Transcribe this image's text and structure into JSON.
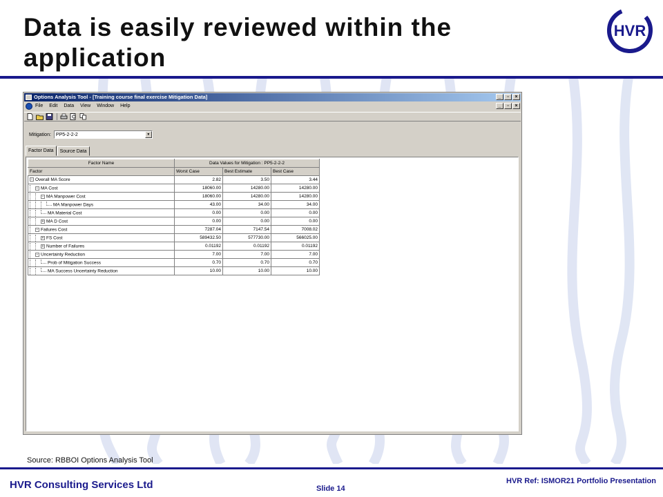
{
  "slide": {
    "title_line1": "Data is easily reviewed within the",
    "title_line2": "application",
    "logo_text": "HVR",
    "source": "Source: RBBOI Options Analysis Tool",
    "footer_company": "HVR Consulting Services Ltd",
    "footer_slide": "Slide 14",
    "footer_ref": "HVR Ref:  ISMOR21 Portfolio Presentation",
    "colors": {
      "brand": "#1a1a8c",
      "window_face": "#d4d0c8",
      "titlebar": "#0a246a"
    }
  },
  "window": {
    "title": "Options Analysis Tool - [Training course final exercise Mitigation Data]",
    "menu": [
      "File",
      "Edit",
      "Data",
      "View",
      "Window",
      "Help"
    ],
    "toolbar_icons": [
      "new-icon",
      "open-icon",
      "save-icon",
      "print-icon",
      "print-preview-icon",
      "copy-icon"
    ],
    "mitigation_label": "Mitigation:",
    "mitigation_value": "PP5-2-2-2",
    "tabs": [
      "Factor Data",
      "Source Data"
    ],
    "active_tab": "Factor Data"
  },
  "grid": {
    "group_header_name": "Factor Name",
    "group_header_values": "Data Values for Mitigation : PP5-2-2-2",
    "columns": [
      "Factor",
      "Worst Case",
      "Best Estimate",
      "Best Case"
    ],
    "rows": [
      {
        "name": "Overall MA Score",
        "level": 0,
        "node": "minus",
        "worst": "2.82",
        "estimate": "3.50",
        "best": "3.44"
      },
      {
        "name": "MA Cost",
        "level": 1,
        "node": "minus",
        "worst": "18060.00",
        "estimate": "14280.00",
        "best": "14280.00"
      },
      {
        "name": "MA Manpower Cost",
        "level": 2,
        "node": "minus",
        "worst": "18060.00",
        "estimate": "14280.00",
        "best": "14280.00"
      },
      {
        "name": "MA Manpower Days",
        "level": 3,
        "node": "leaf",
        "worst": "43.00",
        "estimate": "34.00",
        "best": "34.00"
      },
      {
        "name": "MA Material Cost",
        "level": 2,
        "node": "leaf",
        "worst": "0.00",
        "estimate": "0.00",
        "best": "0.00"
      },
      {
        "name": "MA D Cost",
        "level": 2,
        "node": "plus",
        "worst": "0.00",
        "estimate": "0.00",
        "best": "0.00"
      },
      {
        "name": "Failures Cost",
        "level": 1,
        "node": "minus",
        "worst": "7287.04",
        "estimate": "7147.54",
        "best": "7008.02"
      },
      {
        "name": "FS Cost",
        "level": 2,
        "node": "plus",
        "worst": "589432.50",
        "estimate": "577730.00",
        "best": "566025.00"
      },
      {
        "name": "Number of Failures",
        "level": 2,
        "node": "plus",
        "worst": "0.01192",
        "estimate": "0.01192",
        "best": "0.01192"
      },
      {
        "name": "Uncertainty Reduction",
        "level": 1,
        "node": "minus",
        "worst": "7.00",
        "estimate": "7.00",
        "best": "7.00"
      },
      {
        "name": "Prob of Mitigation Success",
        "level": 2,
        "node": "leaf",
        "worst": "0.70",
        "estimate": "0.70",
        "best": "0.70"
      },
      {
        "name": "MA Success Uncertainty Reduction",
        "level": 2,
        "node": "leaf",
        "worst": "10.00",
        "estimate": "10.00",
        "best": "10.00"
      }
    ]
  }
}
